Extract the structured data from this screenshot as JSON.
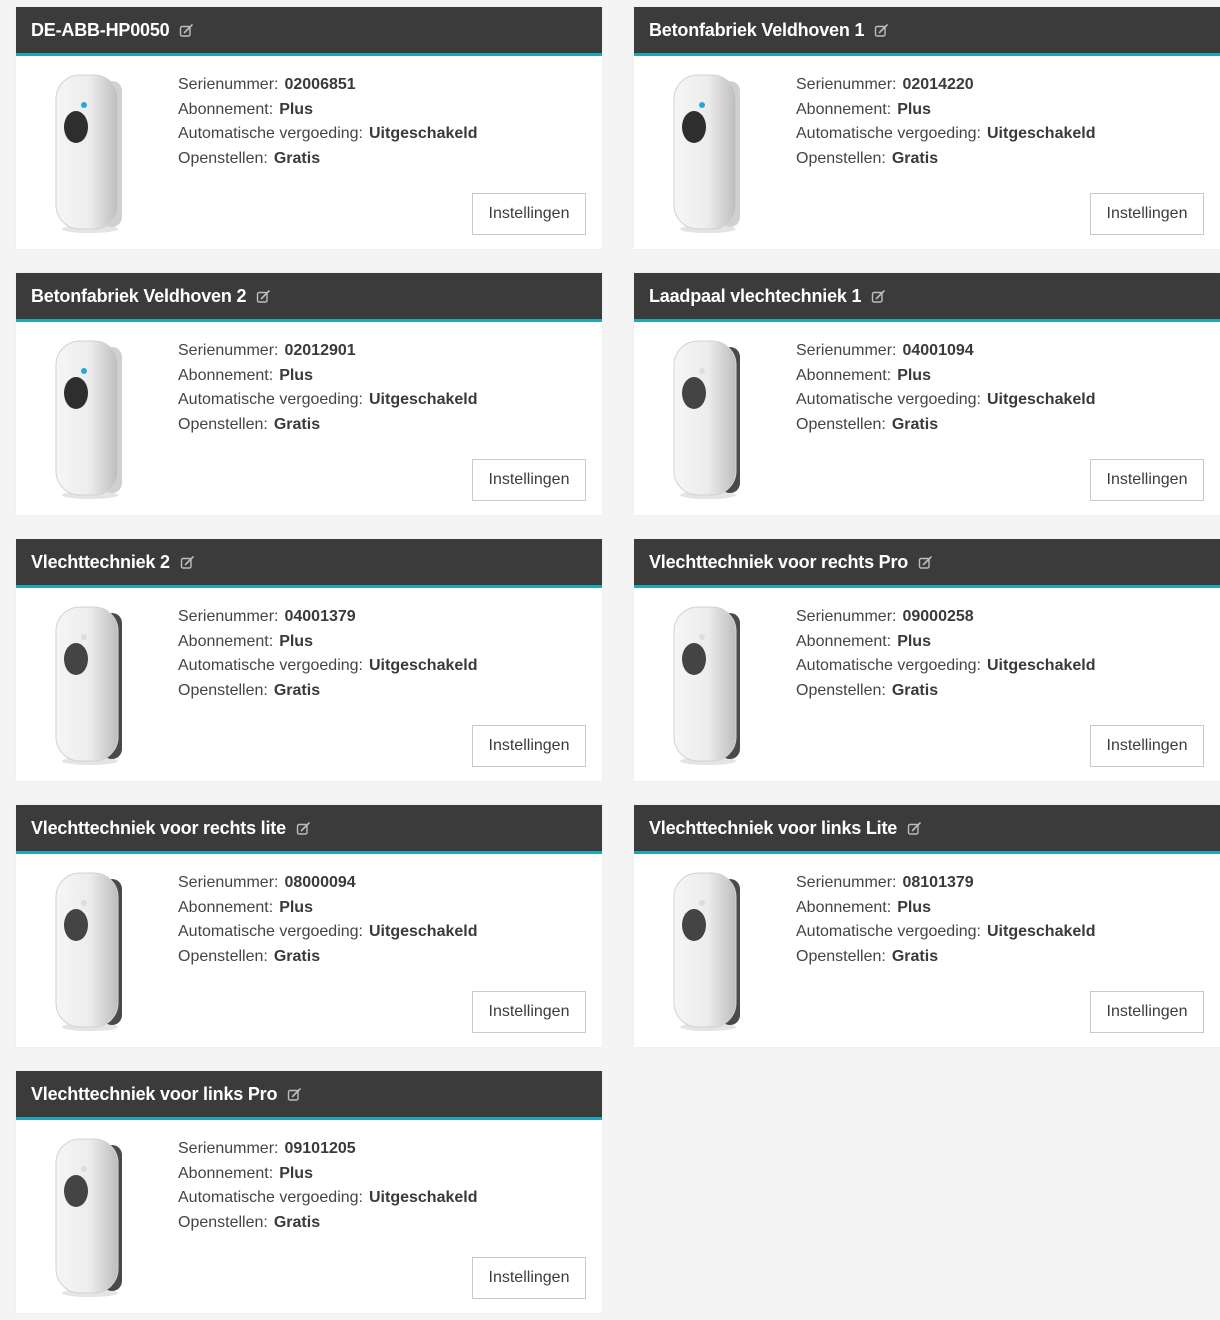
{
  "labels": {
    "serial": "Serienummer:",
    "subscription": "Abonnement:",
    "auto_reimbursement": "Automatische vergoeding:",
    "availability": "Openstellen:",
    "settings_button": "Instellingen"
  },
  "colors": {
    "header_bg": "#3b3b3b",
    "accent": "#1fa6b8",
    "page_bg": "#f4f4f4",
    "card_bg": "#ffffff"
  },
  "chargers": [
    {
      "name": "DE-ABB-HP0050",
      "serial": "02006851",
      "subscription": "Plus",
      "auto_reimbursement": "Uitgeschakeld",
      "availability": "Gratis",
      "device_icon": "charger-with-blue-led-icon"
    },
    {
      "name": "Betonfabriek Veldhoven 1",
      "serial": "02014220",
      "subscription": "Plus",
      "auto_reimbursement": "Uitgeschakeld",
      "availability": "Gratis",
      "device_icon": "charger-with-blue-led-icon"
    },
    {
      "name": "Betonfabriek Veldhoven 2",
      "serial": "02012901",
      "subscription": "Plus",
      "auto_reimbursement": "Uitgeschakeld",
      "availability": "Gratis",
      "device_icon": "charger-with-blue-led-icon"
    },
    {
      "name": "Laadpaal vlechtechniek 1",
      "serial": "04001094",
      "subscription": "Plus",
      "auto_reimbursement": "Uitgeschakeld",
      "availability": "Gratis",
      "device_icon": "charger-icon"
    },
    {
      "name": "Vlechttechniek 2",
      "serial": "04001379",
      "subscription": "Plus",
      "auto_reimbursement": "Uitgeschakeld",
      "availability": "Gratis",
      "device_icon": "charger-icon"
    },
    {
      "name": "Vlechttechniek voor rechts Pro",
      "serial": "09000258",
      "subscription": "Plus",
      "auto_reimbursement": "Uitgeschakeld",
      "availability": "Gratis",
      "device_icon": "charger-icon"
    },
    {
      "name": "Vlechttechniek voor rechts lite",
      "serial": "08000094",
      "subscription": "Plus",
      "auto_reimbursement": "Uitgeschakeld",
      "availability": "Gratis",
      "device_icon": "charger-icon"
    },
    {
      "name": "Vlechttechniek voor links Lite",
      "serial": "08101379",
      "subscription": "Plus",
      "auto_reimbursement": "Uitgeschakeld",
      "availability": "Gratis",
      "device_icon": "charger-icon"
    },
    {
      "name": "Vlechttechniek voor links Pro",
      "serial": "09101205",
      "subscription": "Plus",
      "auto_reimbursement": "Uitgeschakeld",
      "availability": "Gratis",
      "device_icon": "charger-icon"
    }
  ]
}
